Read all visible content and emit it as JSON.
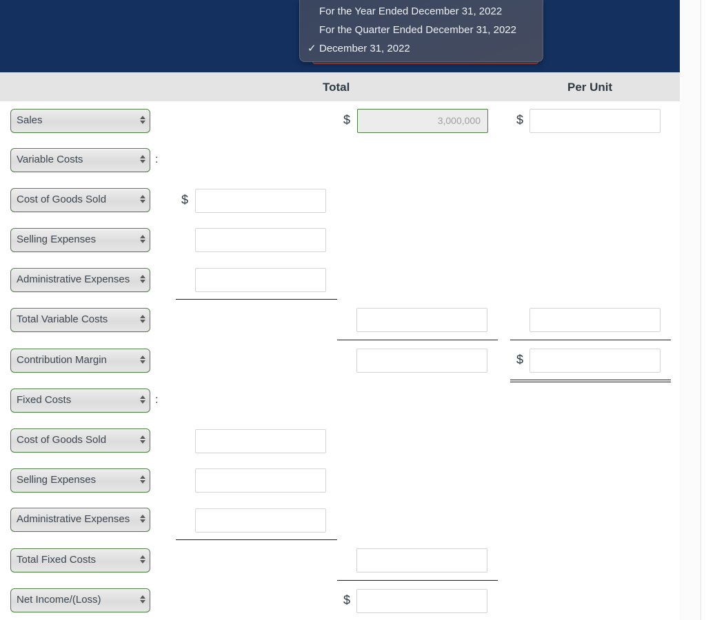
{
  "header": {
    "statement_date_menu": {
      "options": [
        "For the Year Ended December 31, 2022",
        "For the Quarter Ended December 31, 2022",
        "December 31, 2022"
      ],
      "selected_index": 2,
      "check_glyph": "✓"
    }
  },
  "columns": {
    "total": "Total",
    "per_unit": "Per Unit"
  },
  "symbols": {
    "dollar": "$",
    "colon": ":"
  },
  "rows": [
    {
      "label": "Sales",
      "total_value": "3,000,000",
      "total_readonly": true,
      "per_unit_value": ""
    },
    {
      "label": "Variable Costs"
    },
    {
      "label": "Cost of Goods Sold",
      "detail_value": ""
    },
    {
      "label": "Selling Expenses",
      "detail_value": ""
    },
    {
      "label": "Administrative Expenses",
      "detail_value": ""
    },
    {
      "label": "Total Variable Costs",
      "total_value": "",
      "per_unit_value": ""
    },
    {
      "label": "Contribution Margin",
      "total_value": "",
      "per_unit_value": ""
    },
    {
      "label": "Fixed Costs"
    },
    {
      "label": "Cost of Goods Sold",
      "detail_value": ""
    },
    {
      "label": "Selling Expenses",
      "detail_value": ""
    },
    {
      "label": "Administrative Expenses",
      "detail_value": ""
    },
    {
      "label": "Total Fixed Costs",
      "total_value": ""
    },
    {
      "label": "Net Income/(Loss)",
      "total_value": ""
    }
  ],
  "colors": {
    "header_band": "#13305f",
    "column_header_band": "#e4e4e4",
    "select_border": "#4e7d43"
  }
}
